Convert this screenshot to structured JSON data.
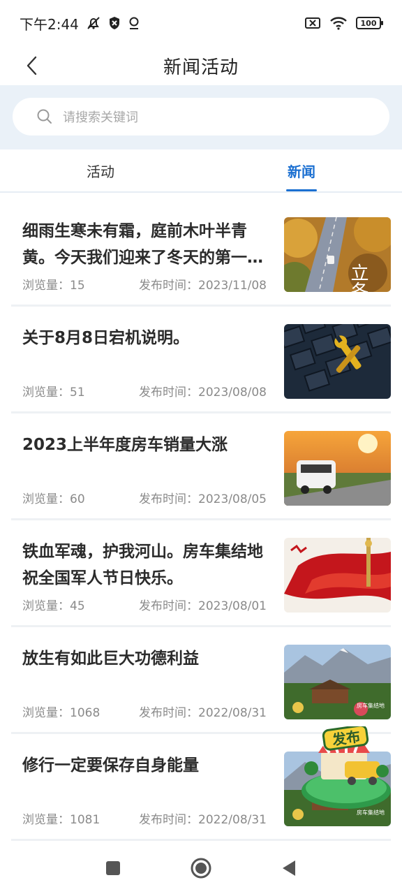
{
  "status_bar": {
    "time": "下午2:44",
    "battery": "100"
  },
  "nav": {
    "title": "新闻活动"
  },
  "search": {
    "placeholder": "请搜索关键词"
  },
  "tabs": [
    {
      "label": "活动",
      "active": false
    },
    {
      "label": "新闻",
      "active": true
    }
  ],
  "meta_labels": {
    "views": "浏览量：",
    "published": "发布时间："
  },
  "news": [
    {
      "title": "细雨生寒未有霜，庭前木叶半青黄。今天我们迎来了冬天的第一个节气——立冬",
      "views": "15",
      "date": "2023/11/08",
      "thumb_text": "立冬"
    },
    {
      "title": "关于8月8日宕机说明。",
      "views": "51",
      "date": "2023/08/08",
      "thumb_text": ""
    },
    {
      "title": "2023上半年度房车销量大涨",
      "views": "60",
      "date": "2023/08/05",
      "thumb_text": ""
    },
    {
      "title": "铁血军魂，护我河山。房车集结地祝全国军人节日快乐。",
      "views": "45",
      "date": "2023/08/01",
      "thumb_text": ""
    },
    {
      "title": "放生有如此巨大功德利益",
      "views": "1068",
      "date": "2022/08/31",
      "thumb_text": "房车集结地"
    },
    {
      "title": "修行一定要保存自身能量",
      "views": "1081",
      "date": "2022/08/31",
      "thumb_text": "房车集结地"
    }
  ],
  "fab": {
    "label": "发布"
  },
  "colors": {
    "accent": "#1a6fd1",
    "search_bg": "#eaf1f8"
  }
}
